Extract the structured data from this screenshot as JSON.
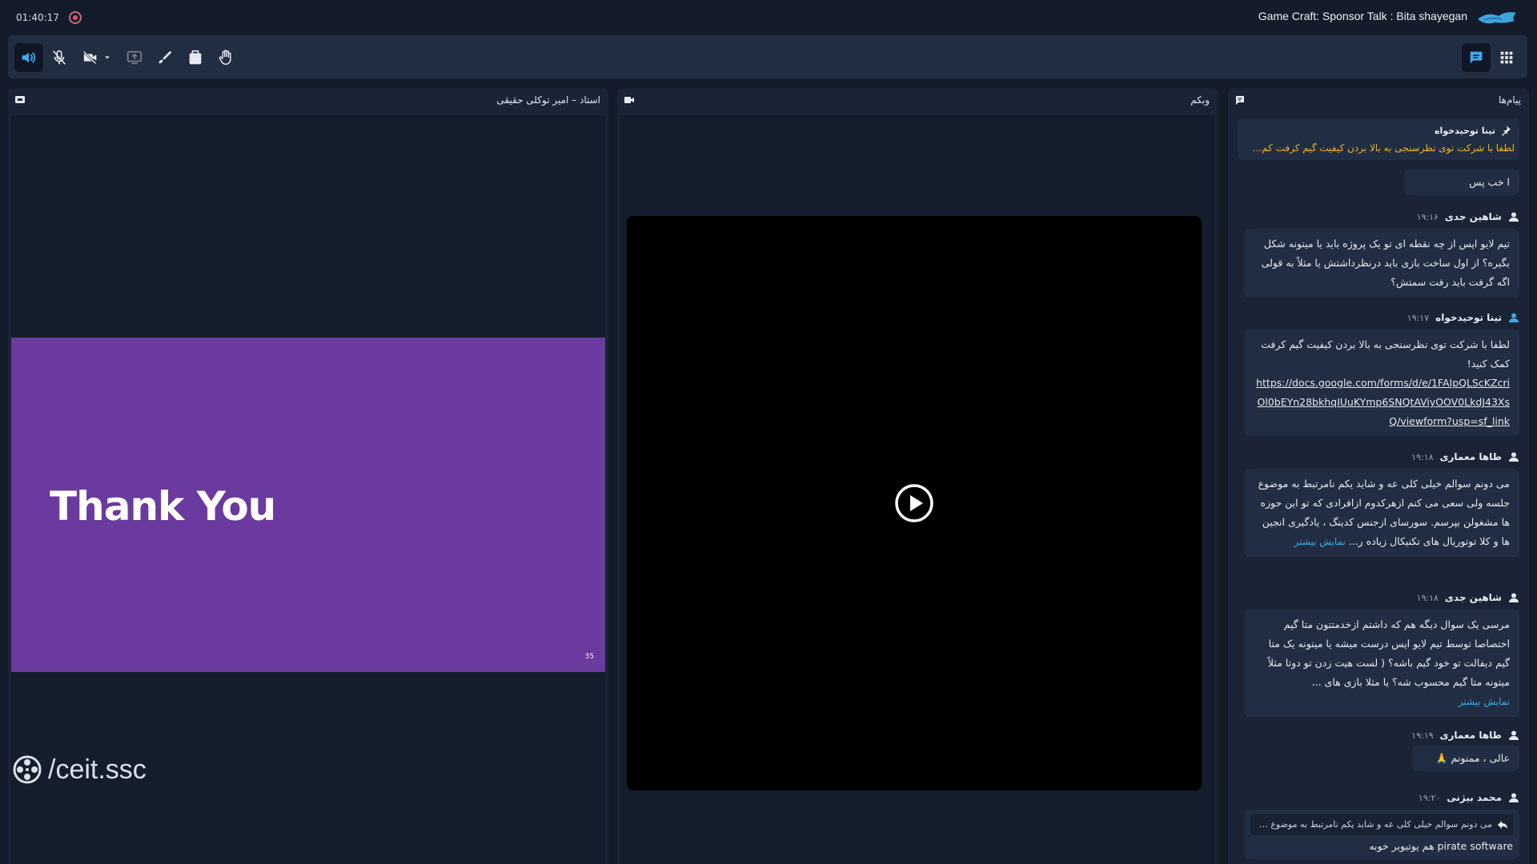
{
  "topbar": {
    "timer": "01:40:17",
    "meeting_title": "Game Craft: Sponsor Talk : Bita shayegan"
  },
  "toolbar": {
    "buttons": [
      "speaker-icon",
      "mic-off-icon",
      "camera-off-icon",
      "screen-share-icon",
      "pen-icon",
      "clipboard-icon",
      "hand-icon"
    ],
    "right_buttons": [
      "chat-icon",
      "grid-icon"
    ]
  },
  "presenter_panel": {
    "title": "استاد – امیر توکلی حقیقی",
    "slide_text": "Thank You",
    "slide_number": "35",
    "watermark": "/ceit.ssc"
  },
  "webcam_panel": {
    "title": "وبکم"
  },
  "chat_panel": {
    "title": "پیام‌ها",
    "pinned": {
      "author": "تینا توحیدخواه",
      "text": "لطفا با شرکت توی نظرسنجی به بالا بردن کیفیت گیم کرفت کم..."
    },
    "messages": [
      {
        "text": "ا خب پس"
      },
      {
        "author": "شاهین جدی",
        "time": "۱۹:۱۶",
        "text": "تیم لایو اپس از چه نقطه ای تو یک پروژه باید یا میتونه شکل بگیره؟ از اول ساخت بازی باید درنظرداشتش یا مثلاً به قولی اگه گرفت باید رفت سمتش؟"
      },
      {
        "author": "تینا توحیدخواه",
        "time": "۱۹:۱۷",
        "text": "لطفا با شرکت توی نظرسنجی به بالا بردن کیفیت گیم کرفت کمک کنید!",
        "link": "https://docs.google.com/forms/d/e/1FAIpQLScKZcriOl0bEYn28bkhqIUuKYmp6SNQtAViyOOV0LkdJ43XsQ/viewform?usp=sf_link"
      },
      {
        "author": "طاها معماری",
        "time": "۱۹:۱۸",
        "text": "می دونم سوالم خیلی کلی عه و شاید یکم نامرتبط به موضوع جلسه ولی سعی می کنم ازهرکدوم ازافرادی که تو این حوزه ها مشغولن بپرسم. سورسای ازجنس کدینگ ، یادگیری انجین ها و کلا توتوریال های تکنیکال زیاده ر... ",
        "more": "نمایش بیشتر"
      },
      {
        "author": "شاهین جدی",
        "time": "۱۹:۱۸",
        "text": "مرسی یک سوال دیگه هم که داشتم ازخدمتتون متا گیم اختصاصا توسط تیم لایو اپس درست میشه یا میتونه یک متا گیم دیفالت تو خود گیم باشه؟ ( لست هیت زدن تو دوتا مثلاً میتونه متا گیم محسوب شه؟ یا مثلا بازی های ...",
        "more": "نمایش بیشتر"
      },
      {
        "author": "طاها معماری",
        "time": "۱۹:۱۹",
        "text": "عالی ، ممنونم 🙏"
      },
      {
        "author": "محمد بیژنی",
        "time": "۱۹:۲۰",
        "quote": "می دونم سوالم خیلی کلی عه و شاید یکم نامرتبط به موضوع ج...",
        "text": "pirate software هم یوتیوبر خوبه"
      }
    ]
  },
  "colors": {
    "accent": "#3da9e8",
    "pinned_text": "#f1b12a",
    "slide_bg": "#6a3a9e",
    "record": "#e04f6b"
  }
}
